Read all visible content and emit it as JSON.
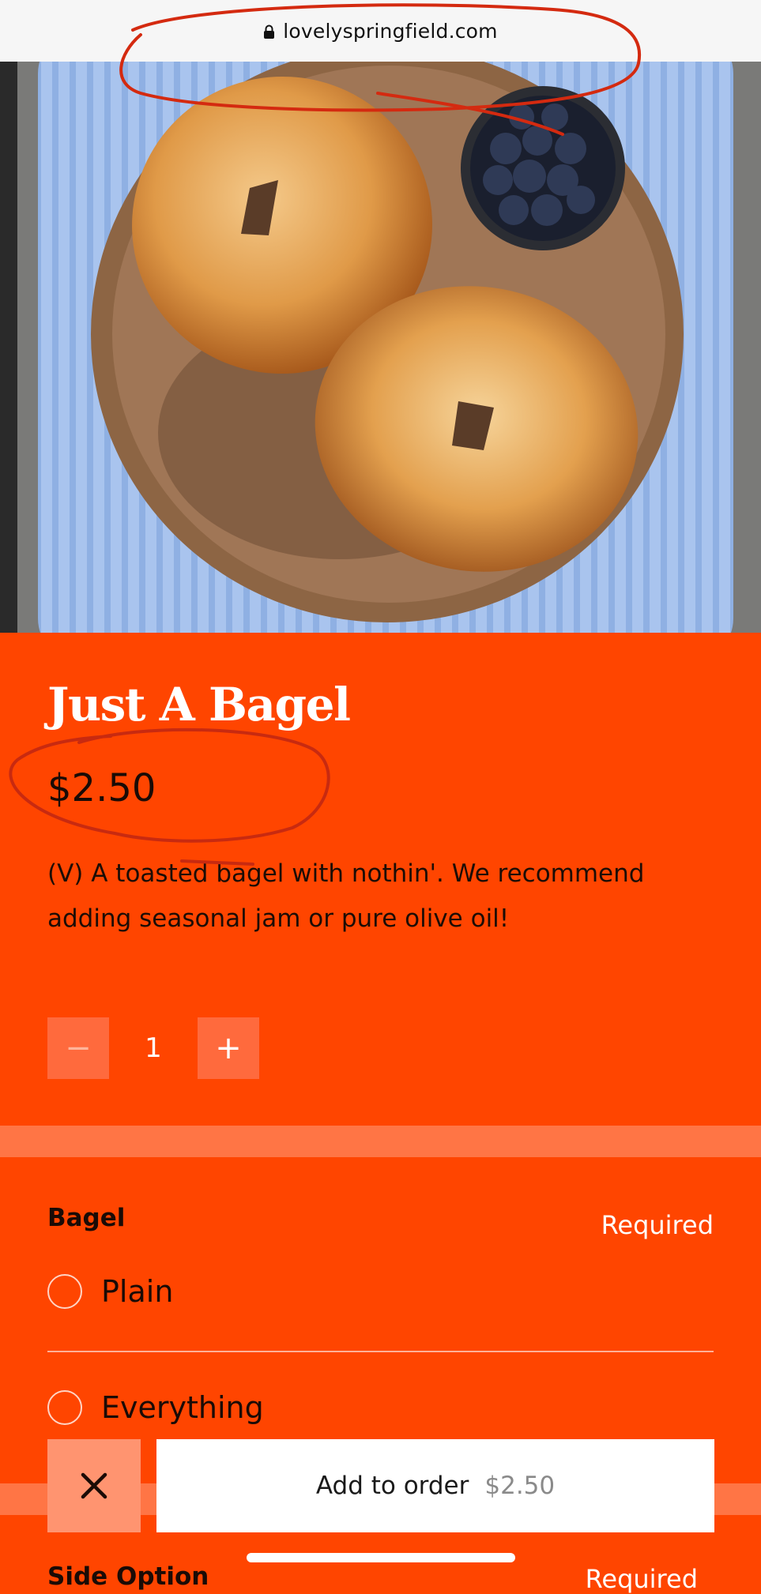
{
  "browser": {
    "url": "lovelyspringfield.com"
  },
  "product": {
    "image_alt": "",
    "title": "Just A Bagel",
    "price": "$2.50",
    "description": "(V) A toasted bagel with nothin'. We recommend adding seasonal jam or pure olive oil!",
    "quantity": "1",
    "minus_label": "−",
    "plus_label": "+"
  },
  "options_group": {
    "title": "Bagel",
    "required_label": "Required",
    "items": [
      {
        "label": "Plain"
      },
      {
        "label": "Everything"
      }
    ]
  },
  "next_group": {
    "title": "Side Option",
    "required_label": "Required"
  },
  "order_bar": {
    "close_label": "✕",
    "add_label": "Add to order",
    "add_amount": "$2.50"
  },
  "colors": {
    "brand": "#ff4500",
    "band": "#ff7545",
    "annotation": "#d42a10"
  },
  "icons": [
    "lock-icon",
    "close-icon",
    "radio-empty-icon"
  ]
}
